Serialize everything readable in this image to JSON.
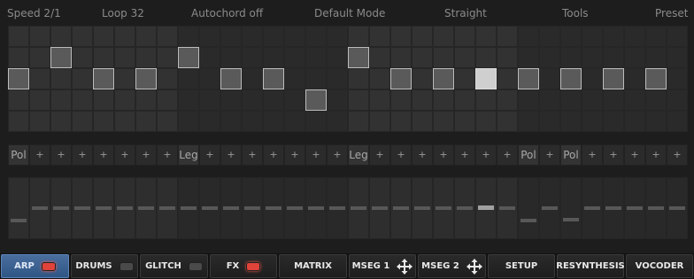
{
  "header": {
    "labels": [
      "Speed 2/1",
      "Loop 32",
      "Autochord off",
      "Default Mode",
      "Straight",
      "Tools",
      "Preset"
    ]
  },
  "sequencer": {
    "steps": 32,
    "rows": 5,
    "notes": [
      {
        "step": 0,
        "row": 2
      },
      {
        "step": 2,
        "row": 1
      },
      {
        "step": 4,
        "row": 2
      },
      {
        "step": 6,
        "row": 2
      },
      {
        "step": 8,
        "row": 1
      },
      {
        "step": 10,
        "row": 2
      },
      {
        "step": 12,
        "row": 2
      },
      {
        "step": 14,
        "row": 3
      },
      {
        "step": 16,
        "row": 1
      },
      {
        "step": 18,
        "row": 2
      },
      {
        "step": 20,
        "row": 2
      },
      {
        "step": 22,
        "row": 2,
        "highlight": true
      },
      {
        "step": 24,
        "row": 2
      },
      {
        "step": 26,
        "row": 2
      },
      {
        "step": 28,
        "row": 2
      },
      {
        "step": 30,
        "row": 2
      }
    ]
  },
  "modes": [
    "Pol",
    "+",
    "+",
    "+",
    "+",
    "+",
    "+",
    "+",
    "Leg",
    "+",
    "+",
    "+",
    "+",
    "+",
    "+",
    "+",
    "Leg",
    "+",
    "+",
    "+",
    "+",
    "+",
    "+",
    "+",
    "Pol",
    "+",
    "Pol",
    "+",
    "+",
    "+",
    "+",
    "+"
  ],
  "velocity": {
    "levels": [
      0.25,
      0.45,
      0.45,
      0.45,
      0.45,
      0.45,
      0.45,
      0.45,
      0.45,
      0.45,
      0.45,
      0.45,
      0.45,
      0.45,
      0.45,
      0.45,
      0.45,
      0.45,
      0.45,
      0.45,
      0.45,
      0.45,
      0.45,
      0.45,
      0.25,
      0.45,
      0.27,
      0.45,
      0.45,
      0.45,
      0.45,
      0.45
    ],
    "highlight_step": 22
  },
  "tabs": [
    {
      "label": "ARP",
      "led": "on",
      "active": true
    },
    {
      "label": "DRUMS",
      "led": "off"
    },
    {
      "label": "GLITCH",
      "led": "off"
    },
    {
      "label": "FX",
      "led": "on"
    },
    {
      "label": "MATRIX"
    },
    {
      "label": "MSEG 1",
      "icon": "move-icon"
    },
    {
      "label": "MSEG 2",
      "icon": "move-icon"
    },
    {
      "label": "SETUP"
    },
    {
      "label": "RESYNTHESIS"
    },
    {
      "label": "VOCODER"
    }
  ],
  "colors": {
    "accent": "#3f6496",
    "led_on": "#e0433a"
  }
}
